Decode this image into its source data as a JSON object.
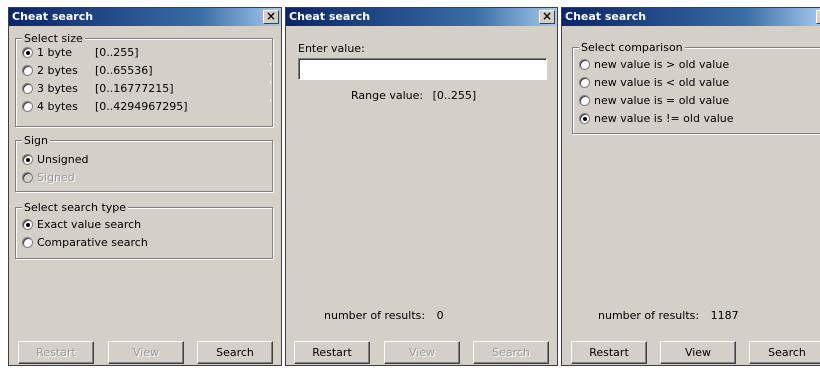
{
  "window1": {
    "title": "Cheat search",
    "size_group": {
      "legend": "Select size",
      "options": [
        {
          "label": "1 byte",
          "range": "[0..255]",
          "checked": true
        },
        {
          "label": "2 bytes",
          "range": "[0..65536]",
          "checked": false
        },
        {
          "label": "3 bytes",
          "range": "[0..16777215]",
          "checked": false
        },
        {
          "label": "4 bytes",
          "range": "[0..4294967295]",
          "checked": false
        }
      ]
    },
    "sign_group": {
      "legend": "Sign",
      "options": [
        {
          "label": "Unsigned",
          "checked": true
        },
        {
          "label": "Signed",
          "checked": false,
          "disabled": true
        }
      ]
    },
    "search_type_group": {
      "legend": "Select search type",
      "options": [
        {
          "label": "Exact value search",
          "checked": true
        },
        {
          "label": "Comparative search",
          "checked": false
        }
      ]
    },
    "buttons": {
      "restart": "Restart",
      "view": "View",
      "search": "Search"
    }
  },
  "window2": {
    "title": "Cheat search",
    "enter_value_label": "Enter value:",
    "input_value": "",
    "range_label": "Range value:",
    "range_value": "[0..255]",
    "results_label": "number of results:",
    "results_count": "0",
    "buttons": {
      "restart": "Restart",
      "view": "View",
      "search": "Search"
    }
  },
  "window3": {
    "title": "Cheat search",
    "comparison_group": {
      "legend": "Select comparison",
      "options": [
        {
          "label": "new value is > old value",
          "checked": false
        },
        {
          "label": "new value is < old value",
          "checked": false
        },
        {
          "label": "new value is = old value",
          "checked": false
        },
        {
          "label": "new value is != old value",
          "checked": true
        }
      ]
    },
    "results_label": "number of results:",
    "results_count": "1187",
    "buttons": {
      "restart": "Restart",
      "view": "View",
      "search": "Search"
    }
  },
  "icons": {
    "close": "close-icon"
  }
}
